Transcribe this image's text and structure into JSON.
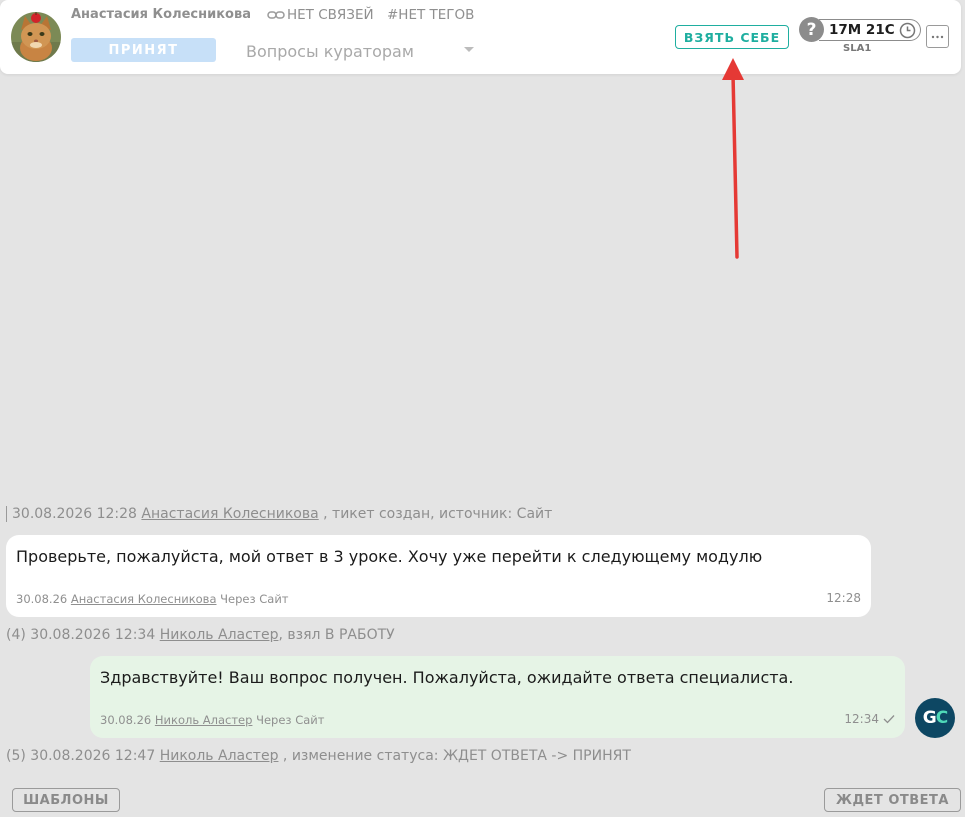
{
  "header": {
    "client_name": "Анастасия Колесникова",
    "links_label": "НЕТ СВЯЗЕЙ",
    "tags_label": "#НЕТ ТЕГОВ",
    "status": "ПРИНЯТ",
    "queue": "Вопросы кураторам",
    "take_button": "ВЗЯТЬ СЕБЕ",
    "sla_help": "?",
    "sla_time": "17М 21С",
    "sla_label": "SLA1",
    "accent_color": "#1faea0",
    "annotation_color": "#e53935"
  },
  "events": [
    {
      "prefix": "30.08.2026 12:28",
      "author": "Анастасия Колесникова",
      "suffix": ", тикет создан, источник: Сайт"
    },
    {
      "prefix": "(4) 30.08.2026 12:34",
      "author": "Николь Аластер",
      "suffix": ", взял В РАБОТУ"
    },
    {
      "prefix": "(5) 30.08.2026 12:47",
      "author": "Николь Аластер",
      "suffix": ", изменение статуса: ЖДЕТ ОТВЕТА -> ПРИНЯТ"
    }
  ],
  "messages": [
    {
      "text": "Проверьте, пожалуйста, мой ответ в 3 уроке. Хочу уже перейти к следующему модулю",
      "date": "30.08.26",
      "author": "Анастасия Колесникова",
      "source": "Через Сайт",
      "time": "12:28"
    },
    {
      "text": "Здравствуйте! Ваш вопрос получен. Пожалуйста, ожидайте ответа специалиста.",
      "date": "30.08.26",
      "author": "Николь Аластер",
      "source": "Через Сайт",
      "time": "12:34"
    }
  ],
  "agent_avatar": {
    "g": "G",
    "c": "C"
  },
  "footer": {
    "templates_button": "ШАБЛОНЫ",
    "status_button": "ЖДЕТ ОТВЕТА"
  }
}
